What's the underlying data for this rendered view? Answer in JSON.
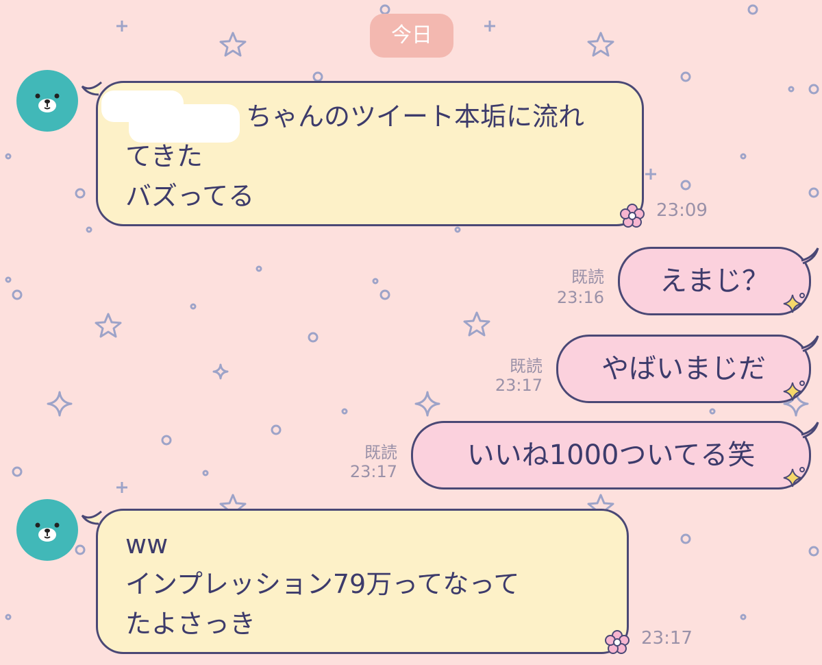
{
  "chat": {
    "date_label": "今日",
    "messages": [
      {
        "direction": "incoming",
        "lines": [
          "ちゃんのツイート本垢に流れ",
          "てきた",
          "バズってる"
        ],
        "time": "23:09"
      },
      {
        "direction": "outgoing",
        "text": "えまじ？",
        "read": "既読",
        "time": "23:16"
      },
      {
        "direction": "outgoing",
        "text": "やばいまじだ",
        "read": "既読",
        "time": "23:17"
      },
      {
        "direction": "outgoing",
        "text": "いいね1000ついてる笑",
        "read": "既読",
        "time": "23:17"
      },
      {
        "direction": "incoming",
        "lines": [
          "ww",
          "インプレッション79万ってなって",
          "たよさっき"
        ],
        "time": "23:17"
      }
    ]
  },
  "colors": {
    "background": "#fde0dd",
    "incoming_bubble": "#fdf1c8",
    "outgoing_bubble": "#fbd1dd",
    "outline": "#4a4875",
    "avatar": "#41b8b8",
    "date_pill": "#f3b8b0",
    "meta_text": "#9a91a8"
  },
  "icons": [
    "bear-avatar-icon",
    "flower-icon",
    "sparkle-icon",
    "star-icon"
  ]
}
